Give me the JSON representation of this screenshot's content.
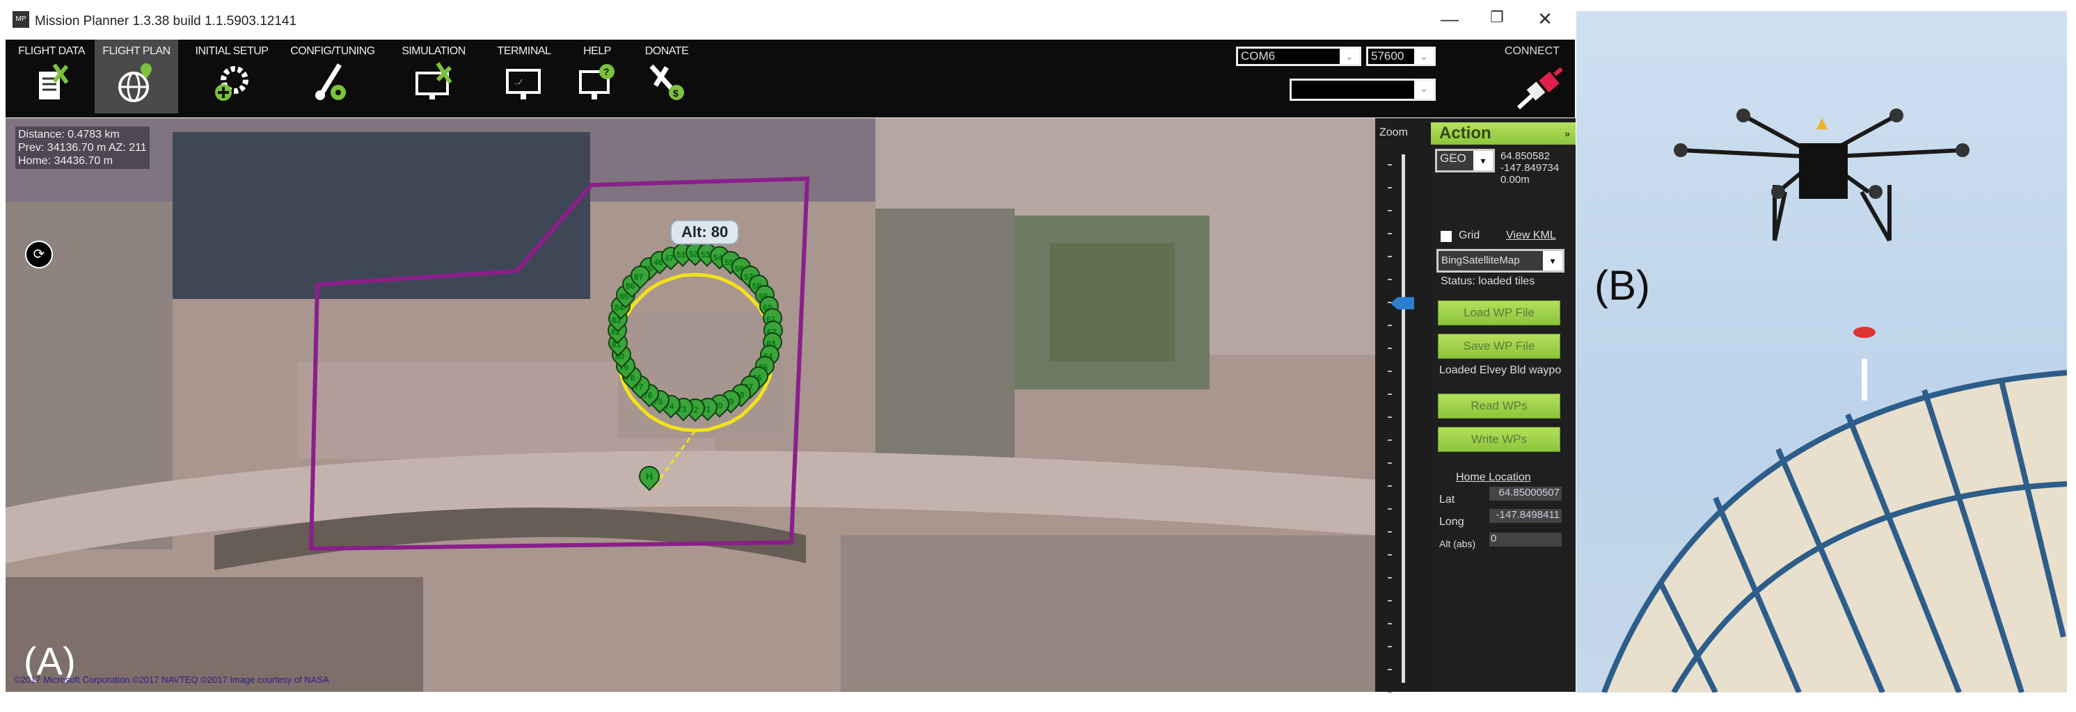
{
  "window": {
    "title": "Mission Planner 1.3.38 build 1.1.5903.12141",
    "app_icon": "MP",
    "minimize": "—",
    "maximize": "❐",
    "close": "✕"
  },
  "toolbar": {
    "items": [
      {
        "label": "FLIGHT DATA",
        "icon": "flight-data-icon"
      },
      {
        "label": "FLIGHT PLAN",
        "icon": "flight-plan-icon",
        "active": true
      },
      {
        "label": "INITIAL SETUP",
        "icon": "initial-setup-icon"
      },
      {
        "label": "CONFIG/TUNING",
        "icon": "config-tuning-icon"
      },
      {
        "label": "SIMULATION",
        "icon": "simulation-icon"
      },
      {
        "label": "TERMINAL",
        "icon": "terminal-icon"
      },
      {
        "label": "HELP",
        "icon": "help-icon"
      },
      {
        "label": "DONATE",
        "icon": "donate-icon"
      }
    ],
    "port": "COM6",
    "baud": "57600",
    "link": "",
    "connect_label": "CONNECT"
  },
  "map": {
    "info": {
      "distance": "Distance: 0.4783 km",
      "prev": "Prev: 34136.70 m AZ: 211",
      "home": "Home: 34436.70 m"
    },
    "compass": "⟳",
    "alt_label": "Alt: 80",
    "waypoints": [
      "45",
      "46",
      "47",
      "51",
      "52",
      "53",
      "54",
      "55",
      "56",
      "57",
      "58",
      "59",
      "60",
      "61",
      "62",
      "63",
      "64",
      "65",
      "66",
      "67",
      "68",
      "69",
      "70",
      "71",
      "72",
      "73",
      "74",
      "75",
      "76",
      "77",
      "78",
      "79",
      "80",
      "81",
      "82",
      "83",
      "84",
      "85",
      "86",
      "87"
    ],
    "home_marker": "H",
    "copyright": "©2017 Microsoft Corporation ©2017 NAVTEQ ©2017 Image courtesy of NASA",
    "panel_label": "(A)"
  },
  "zoom": {
    "label": "Zoom",
    "level": 0.27
  },
  "action": {
    "header": "Action",
    "collapse": "»",
    "coord_system": "GEO",
    "lat": "64.850582",
    "lng": "-147.849734",
    "alt": "0.00m",
    "grid_label": "Grid",
    "view_kml": "View KML",
    "map_provider": "BingSatelliteMap",
    "status": "Status: loaded tiles",
    "load_wp": "Load WP File",
    "save_wp": "Save WP File",
    "loaded_msg": "Loaded Elvey Bld waypo",
    "read_wps": "Read WPs",
    "write_wps": "Write WPs",
    "home_location": "Home Location",
    "home_lat_label": "Lat",
    "home_lat": "64.85000507",
    "home_long_label": "Long",
    "home_long": "-147.8498411",
    "home_alt_label": "Alt (abs)",
    "home_alt": "0"
  },
  "photo": {
    "panel_label": "(B)"
  },
  "colors": {
    "accent_green": "#8cc43c",
    "polygon": "#8a1f8a",
    "path": "#f2e21a",
    "marker": "#3aa43a"
  }
}
